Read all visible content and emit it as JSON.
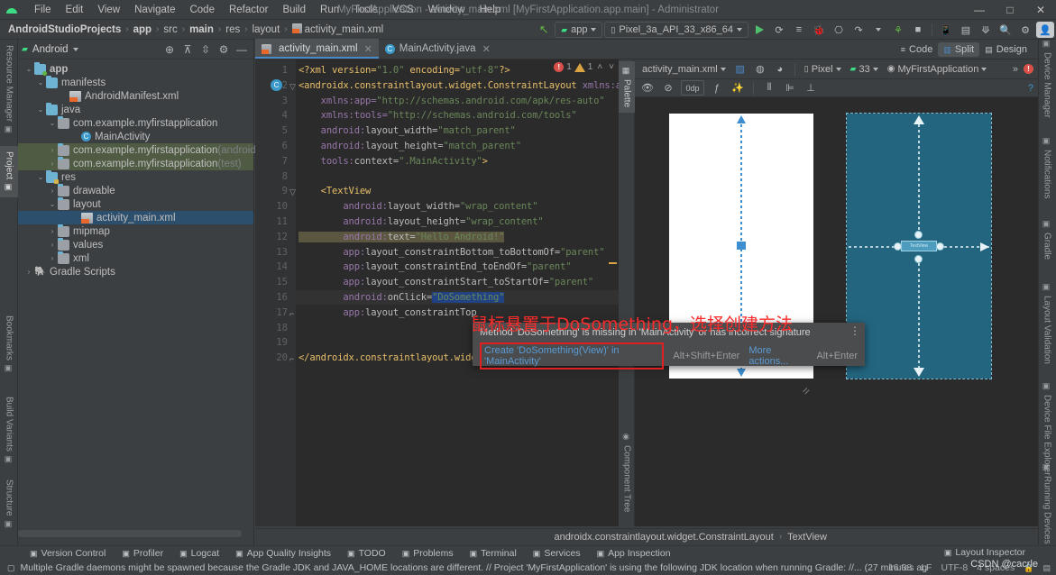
{
  "window": {
    "title": "MyFirstApplication - activity_main.xml [MyFirstApplication.app.main] - Administrator",
    "minimize": "—",
    "maximize": "□",
    "close": "✕"
  },
  "menu": [
    "File",
    "Edit",
    "View",
    "Navigate",
    "Code",
    "Refactor",
    "Build",
    "Run",
    "Tools",
    "VCS",
    "Window",
    "Help"
  ],
  "breadcrumbs": [
    {
      "label": "AndroidStudioProjects",
      "bold": true
    },
    {
      "label": "app",
      "bold": true
    },
    {
      "label": "src",
      "bold": false
    },
    {
      "label": "main",
      "bold": true
    },
    {
      "label": "res",
      "bold": false
    },
    {
      "label": "layout",
      "bold": false
    },
    {
      "label": "activity_main.xml",
      "bold": false,
      "icon": "xml-file-icon"
    }
  ],
  "toolbar": {
    "app_config": "app",
    "device": "Pixel_3a_API_33_x86_64",
    "run_icon": "run-icon",
    "actions": [
      "apply-changes-icon",
      "apply-code-changes-icon",
      "debug-icon",
      "attach-debugger-icon",
      "rerun-icon",
      "profile-icon",
      "stop-icon",
      "avd-manager-icon",
      "sdk-manager-icon",
      "sync-gradle-icon",
      "search-icon",
      "settings-icon",
      "account-icon"
    ]
  },
  "project_panel": {
    "title": "Android",
    "header_icons": [
      "locate-icon",
      "collapse-all-icon",
      "expand-icon",
      "settings-icon",
      "hide-icon"
    ],
    "tree": [
      {
        "label": "app",
        "indent": 0,
        "arrow": "v",
        "icon": "module-folder-icon",
        "bold": true
      },
      {
        "label": "manifests",
        "indent": 1,
        "arrow": "v",
        "icon": "folder-icon"
      },
      {
        "label": "AndroidManifest.xml",
        "indent": 3,
        "arrow": "",
        "icon": "xml-file-icon"
      },
      {
        "label": "java",
        "indent": 1,
        "arrow": "v",
        "icon": "folder-icon"
      },
      {
        "label": "com.example.myfirstapplication",
        "indent": 2,
        "arrow": "v",
        "icon": "package-icon"
      },
      {
        "label": "MainActivity",
        "indent": 4,
        "arrow": "",
        "icon": "class-icon"
      },
      {
        "label": "com.example.myfirstapplication",
        "suffix": " (androidTest)",
        "indent": 2,
        "arrow": ">",
        "icon": "package-icon",
        "highlight": "green"
      },
      {
        "label": "com.example.myfirstapplication",
        "suffix": " (test)",
        "indent": 2,
        "arrow": ">",
        "icon": "package-icon",
        "highlight": "green"
      },
      {
        "label": "res",
        "indent": 1,
        "arrow": "v",
        "icon": "res-folder-icon"
      },
      {
        "label": "drawable",
        "indent": 2,
        "arrow": ">",
        "icon": "package-icon"
      },
      {
        "label": "layout",
        "indent": 2,
        "arrow": "v",
        "icon": "package-icon"
      },
      {
        "label": "activity_main.xml",
        "indent": 4,
        "arrow": "",
        "icon": "xml-file-icon",
        "selected": true
      },
      {
        "label": "mipmap",
        "indent": 2,
        "arrow": ">",
        "icon": "package-icon"
      },
      {
        "label": "values",
        "indent": 2,
        "arrow": ">",
        "icon": "package-icon"
      },
      {
        "label": "xml",
        "indent": 2,
        "arrow": ">",
        "icon": "package-icon"
      },
      {
        "label": "Gradle Scripts",
        "indent": 0,
        "arrow": ">",
        "icon": "gradle-icon"
      }
    ]
  },
  "left_tool_tabs": [
    {
      "label": "Resource Manager",
      "icon": "resource-manager-icon",
      "selected": false
    },
    {
      "label": "Project",
      "icon": "project-icon",
      "selected": true
    },
    {
      "label": "Bookmarks",
      "icon": "bookmarks-icon",
      "selected": false
    },
    {
      "label": "Build Variants",
      "icon": "build-variants-icon",
      "selected": false
    },
    {
      "label": "Structure",
      "icon": "structure-icon",
      "selected": false
    }
  ],
  "right_tool_tabs": [
    {
      "label": "Device Manager",
      "icon": "device-manager-icon"
    },
    {
      "label": "Notifications",
      "icon": "notifications-icon"
    },
    {
      "label": "Gradle",
      "icon": "gradle-icon"
    },
    {
      "label": "Layout Validation",
      "icon": "layout-validation-icon"
    },
    {
      "label": "Device File Explorer",
      "icon": "device-file-explorer-icon"
    },
    {
      "label": "Running Devices",
      "icon": "running-devices-icon"
    }
  ],
  "editor_tabs": [
    {
      "label": "activity_main.xml",
      "icon": "xml-file-icon",
      "active": true,
      "close": "✕"
    },
    {
      "label": "MainActivity.java",
      "icon": "class-icon",
      "active": false,
      "close": "✕"
    }
  ],
  "view_modes": [
    {
      "label": "Code",
      "icon": "code-icon",
      "active": false
    },
    {
      "label": "Split",
      "icon": "split-icon",
      "active": true
    },
    {
      "label": "Design",
      "icon": "design-icon",
      "active": false
    }
  ],
  "inspections": {
    "errors": "1",
    "warnings": "1",
    "up": "˄",
    "down": "˅"
  },
  "code_lines": [
    {
      "n": "1",
      "segments": [
        {
          "t": "<?xml version=",
          "c": "t-tag"
        },
        {
          "t": "\"1.0\"",
          "c": "t-str"
        },
        {
          "t": " encoding=",
          "c": "t-tag"
        },
        {
          "t": "\"utf-8\"",
          "c": "t-str"
        },
        {
          "t": "?>",
          "c": "t-tag"
        }
      ]
    },
    {
      "n": "2",
      "segments": [
        {
          "t": "<androidx.constraintlayout.widget.ConstraintLayout ",
          "c": "t-tag"
        },
        {
          "t": "xmlns:a",
          "c": "t-ns"
        }
      ]
    },
    {
      "n": "3",
      "segments": [
        {
          "t": "    xmlns:app=",
          "c": "t-ns"
        },
        {
          "t": "\"http://schemas.android.com/apk/res-auto\"",
          "c": "t-str"
        }
      ]
    },
    {
      "n": "4",
      "segments": [
        {
          "t": "    xmlns:tools=",
          "c": "t-ns"
        },
        {
          "t": "\"http://schemas.android.com/tools\"",
          "c": "t-str"
        }
      ]
    },
    {
      "n": "5",
      "segments": [
        {
          "t": "    android:",
          "c": "t-ns"
        },
        {
          "t": "layout_width=",
          "c": "t-attr"
        },
        {
          "t": "\"match_parent\"",
          "c": "t-str"
        }
      ]
    },
    {
      "n": "6",
      "segments": [
        {
          "t": "    android:",
          "c": "t-ns"
        },
        {
          "t": "layout_height=",
          "c": "t-attr"
        },
        {
          "t": "\"match_parent\"",
          "c": "t-str"
        }
      ]
    },
    {
      "n": "7",
      "segments": [
        {
          "t": "    tools:",
          "c": "t-ns"
        },
        {
          "t": "context=",
          "c": "t-attr"
        },
        {
          "t": "\".MainActivity\"",
          "c": "t-str"
        },
        {
          "t": ">",
          "c": "t-tag"
        }
      ]
    },
    {
      "n": "8",
      "segments": []
    },
    {
      "n": "9",
      "segments": [
        {
          "t": "    <TextView",
          "c": "t-tag"
        }
      ]
    },
    {
      "n": "10",
      "segments": [
        {
          "t": "        android:",
          "c": "t-ns"
        },
        {
          "t": "layout_width=",
          "c": "t-attr"
        },
        {
          "t": "\"wrap_content\"",
          "c": "t-str"
        }
      ]
    },
    {
      "n": "11",
      "segments": [
        {
          "t": "        android:",
          "c": "t-ns"
        },
        {
          "t": "layout_height=",
          "c": "t-attr"
        },
        {
          "t": "\"wrap_content\"",
          "c": "t-str"
        }
      ]
    },
    {
      "n": "12",
      "segments": [
        {
          "t": "        android:",
          "c": "t-ns"
        },
        {
          "t": "text=",
          "c": "t-attr"
        },
        {
          "t": "\"Hello Android!\"",
          "c": "t-str"
        }
      ],
      "highlight_text": true
    },
    {
      "n": "13",
      "segments": [
        {
          "t": "        app:",
          "c": "t-ns"
        },
        {
          "t": "layout_constraintBottom_toBottomOf=",
          "c": "t-attr"
        },
        {
          "t": "\"parent\"",
          "c": "t-str"
        }
      ]
    },
    {
      "n": "14",
      "segments": [
        {
          "t": "        app:",
          "c": "t-ns"
        },
        {
          "t": "layout_constraintEnd_toEndOf=",
          "c": "t-attr"
        },
        {
          "t": "\"parent\"",
          "c": "t-str"
        }
      ]
    },
    {
      "n": "15",
      "segments": [
        {
          "t": "        app:",
          "c": "t-ns"
        },
        {
          "t": "layout_constraintStart_toStartOf=",
          "c": "t-attr"
        },
        {
          "t": "\"parent\"",
          "c": "t-str"
        }
      ]
    },
    {
      "n": "16",
      "segments": [
        {
          "t": "        android:",
          "c": "t-ns"
        },
        {
          "t": "onClick=",
          "c": "t-attr"
        },
        {
          "t": "\"DoSomething\"",
          "c": "t-sel"
        }
      ],
      "caret": true
    },
    {
      "n": "17",
      "segments": [
        {
          "t": "        app:",
          "c": "t-ns"
        },
        {
          "t": "layout_constraintTop",
          "c": "t-attr"
        }
      ]
    },
    {
      "n": "18",
      "segments": []
    },
    {
      "n": "19",
      "segments": []
    },
    {
      "n": "20",
      "segments": [
        {
          "t": "</androidx.constraintlayout.widget.ConstraintLayout>",
          "c": "t-tag"
        }
      ]
    }
  ],
  "design_toolbar": {
    "file": "activity_main.xml",
    "icons_row1": [
      "design-surface-icon",
      "orientation-icon",
      "theme-icon"
    ],
    "device": "Pixel",
    "api": "33",
    "theme": "MyFirstApplication",
    "overflow": "»",
    "error_badge": "error-icon",
    "icons_row2": [
      "visibility-icon",
      "blueprint-icon",
      "margin-icon",
      "constraint-icon",
      "magic-icon",
      "align-icon",
      "distribute-icon",
      "baseline-icon"
    ],
    "zero_dp": "0dp",
    "help_badge": "help-icon"
  },
  "design_canvas": {
    "textview_label": "TextView",
    "design_surface_bg": "#2b2b2b",
    "blueprint_color": "#23657f",
    "device_white": "#ffffff"
  },
  "palette_tab": "Palette",
  "component_tree_tab": "Component Tree",
  "tooltip": {
    "message": "Method 'DoSomething' is missing in 'MainActivity' or has incorrect signature",
    "action": "Create 'DoSomething(View)' in 'MainActivity'",
    "action_shortcut": "Alt+Shift+Enter",
    "more": "More actions...",
    "more_shortcut": "Alt+Enter",
    "kebab": "⋮"
  },
  "annotation": {
    "text": "鼠标悬置于DoSomething，选择创建方法",
    "color": "#fb2c2c"
  },
  "component_breadcrumb": [
    "androidx.constraintlayout.widget.ConstraintLayout",
    "TextView"
  ],
  "status_bar": [
    {
      "label": "Version Control",
      "icon": "vcs-icon"
    },
    {
      "label": "Profiler",
      "icon": "profiler-icon"
    },
    {
      "label": "Logcat",
      "icon": "logcat-icon"
    },
    {
      "label": "App Quality Insights",
      "icon": "app-quality-icon"
    },
    {
      "label": "TODO",
      "icon": "todo-icon"
    },
    {
      "label": "Problems",
      "icon": "problems-icon"
    },
    {
      "label": "Terminal",
      "icon": "terminal-icon"
    },
    {
      "label": "Services",
      "icon": "services-icon"
    },
    {
      "label": "App Inspection",
      "icon": "app-inspection-icon"
    }
  ],
  "layout_inspector": {
    "label": "Layout Inspector",
    "icon": "layout-inspector-icon"
  },
  "message_bar": {
    "icon": "event-log-icon",
    "text": "Multiple Gradle daemons might be spawned because the Gradle JDK and JAVA_HOME locations are different. // Project 'MyFirstApplication' is using the following JDK location when running Gradle: //... (27 minutes ag",
    "time": "16:38",
    "line_sep": "LF",
    "encoding": "UTF-8",
    "indent": "4 spaces",
    "lock": "lock-icon"
  },
  "watermark": "CSDN @cacrle"
}
